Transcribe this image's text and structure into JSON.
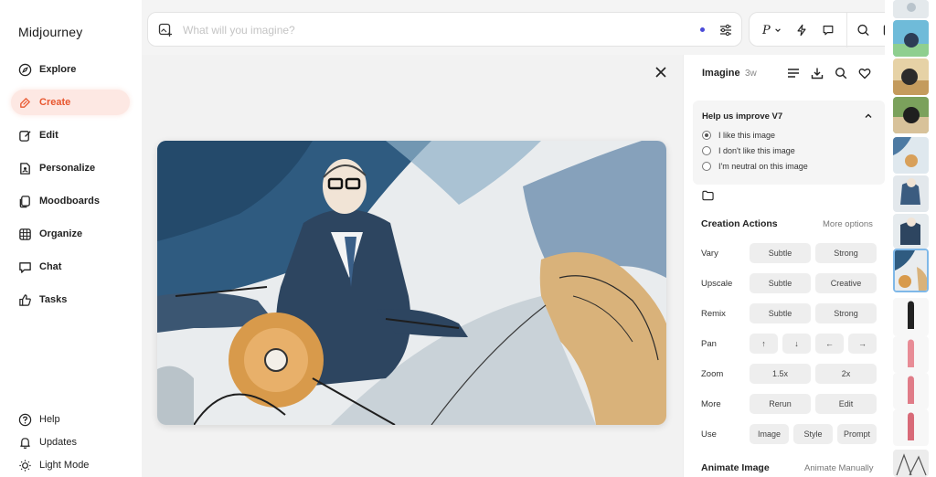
{
  "brand": "Midjourney",
  "nav": [
    {
      "label": "Explore",
      "icon": "compass-icon"
    },
    {
      "label": "Create",
      "icon": "brush-icon",
      "active": true
    },
    {
      "label": "Edit",
      "icon": "edit-icon"
    },
    {
      "label": "Personalize",
      "icon": "personalize-icon"
    },
    {
      "label": "Moodboards",
      "icon": "moodboards-icon"
    },
    {
      "label": "Organize",
      "icon": "grid-icon"
    },
    {
      "label": "Chat",
      "icon": "chat-icon"
    },
    {
      "label": "Tasks",
      "icon": "thumbs-up-icon"
    }
  ],
  "nav_bottom": [
    {
      "label": "Help",
      "icon": "help-icon"
    },
    {
      "label": "Updates",
      "icon": "bell-icon"
    },
    {
      "label": "Light Mode",
      "icon": "sun-icon"
    }
  ],
  "prompt": {
    "placeholder": "What will you imagine?",
    "value": ""
  },
  "toolbar": {
    "personalize_glyph": "P"
  },
  "panel": {
    "title": "Imagine",
    "age": "3w",
    "feedback": {
      "heading": "Help us improve V7",
      "options": [
        {
          "label": "I like this image",
          "selected": true
        },
        {
          "label": "I don't like this image",
          "selected": false
        },
        {
          "label": "I'm neutral on this image",
          "selected": false
        }
      ]
    },
    "creation_actions": {
      "title": "Creation Actions",
      "more": "More options",
      "rows": [
        {
          "label": "Vary",
          "buttons": [
            "Subtle",
            "Strong"
          ]
        },
        {
          "label": "Upscale",
          "buttons": [
            "Subtle",
            "Creative"
          ]
        },
        {
          "label": "Remix",
          "buttons": [
            "Subtle",
            "Strong"
          ]
        },
        {
          "label": "Pan",
          "buttons": [
            "↑",
            "↓",
            "←",
            "→"
          ]
        },
        {
          "label": "Zoom",
          "buttons": [
            "1.5x",
            "2x"
          ]
        },
        {
          "label": "More",
          "buttons": [
            "Rerun",
            "Edit"
          ]
        },
        {
          "label": "Use",
          "buttons": [
            "Image",
            "Style",
            "Prompt"
          ]
        }
      ]
    },
    "animate": {
      "title": "Animate Image",
      "link": "Animate Manually"
    }
  },
  "colors": {
    "accent": "#e8562e",
    "accent_bg": "#fde8e3",
    "status_dot": "#4b4bd8"
  }
}
